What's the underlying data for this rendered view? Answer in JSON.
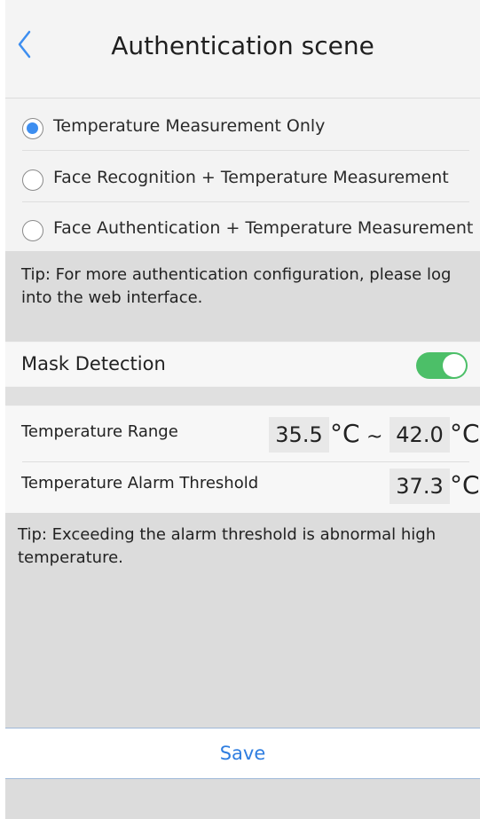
{
  "header": {
    "title": "Authentication scene",
    "back_icon": "chevron-left-icon"
  },
  "modes": [
    {
      "label": "Temperature Measurement Only",
      "selected": true
    },
    {
      "label": "Face Recognition + Temperature Measurement",
      "selected": false
    },
    {
      "label": "Face Authentication + Temperature Measurement",
      "selected": false
    }
  ],
  "tip1": {
    "line1": "Tip: For more authentication configuration, please log",
    "line2": "into the web interface."
  },
  "mask": {
    "label": "Mask Detection",
    "enabled": true
  },
  "temperature": {
    "range_label": "Temperature Range",
    "min": "35.5",
    "max": "42.0",
    "separator": "~",
    "unit": "°C",
    "alarm_label": "Temperature Alarm Threshold",
    "alarm": "37.3"
  },
  "tip2": {
    "line1": "Tip: Exceeding the alarm threshold is abnormal high",
    "line2": "temperature."
  },
  "save_label": "Save",
  "colors": {
    "accent": "#3d8ef0",
    "toggle_on": "#4cbf68",
    "save_text": "#2e7de0"
  }
}
